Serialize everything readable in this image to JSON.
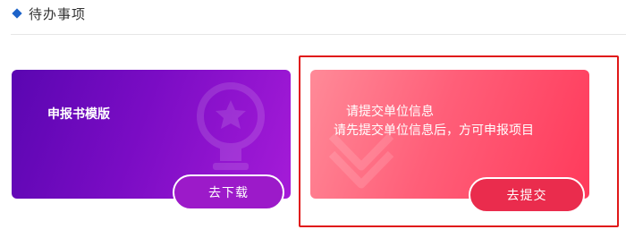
{
  "section": {
    "title": "待办事项",
    "icon": "diamond-icon",
    "accent_color": "#1d63c9"
  },
  "cards": {
    "template": {
      "title": "申报书模版",
      "button_label": "去下载",
      "icon": "trophy-icon",
      "gradient": [
        "#5a06b1",
        "#a51bd8"
      ]
    },
    "company": {
      "title": "请提交单位信息",
      "description": "请先提交单位信息后，方可申报项目",
      "button_label": "去提交",
      "icon": "chevron-down-icon",
      "gradient": [
        "#ff8a98",
        "#ff3a5b"
      ]
    }
  },
  "highlight_color": "#e01818"
}
